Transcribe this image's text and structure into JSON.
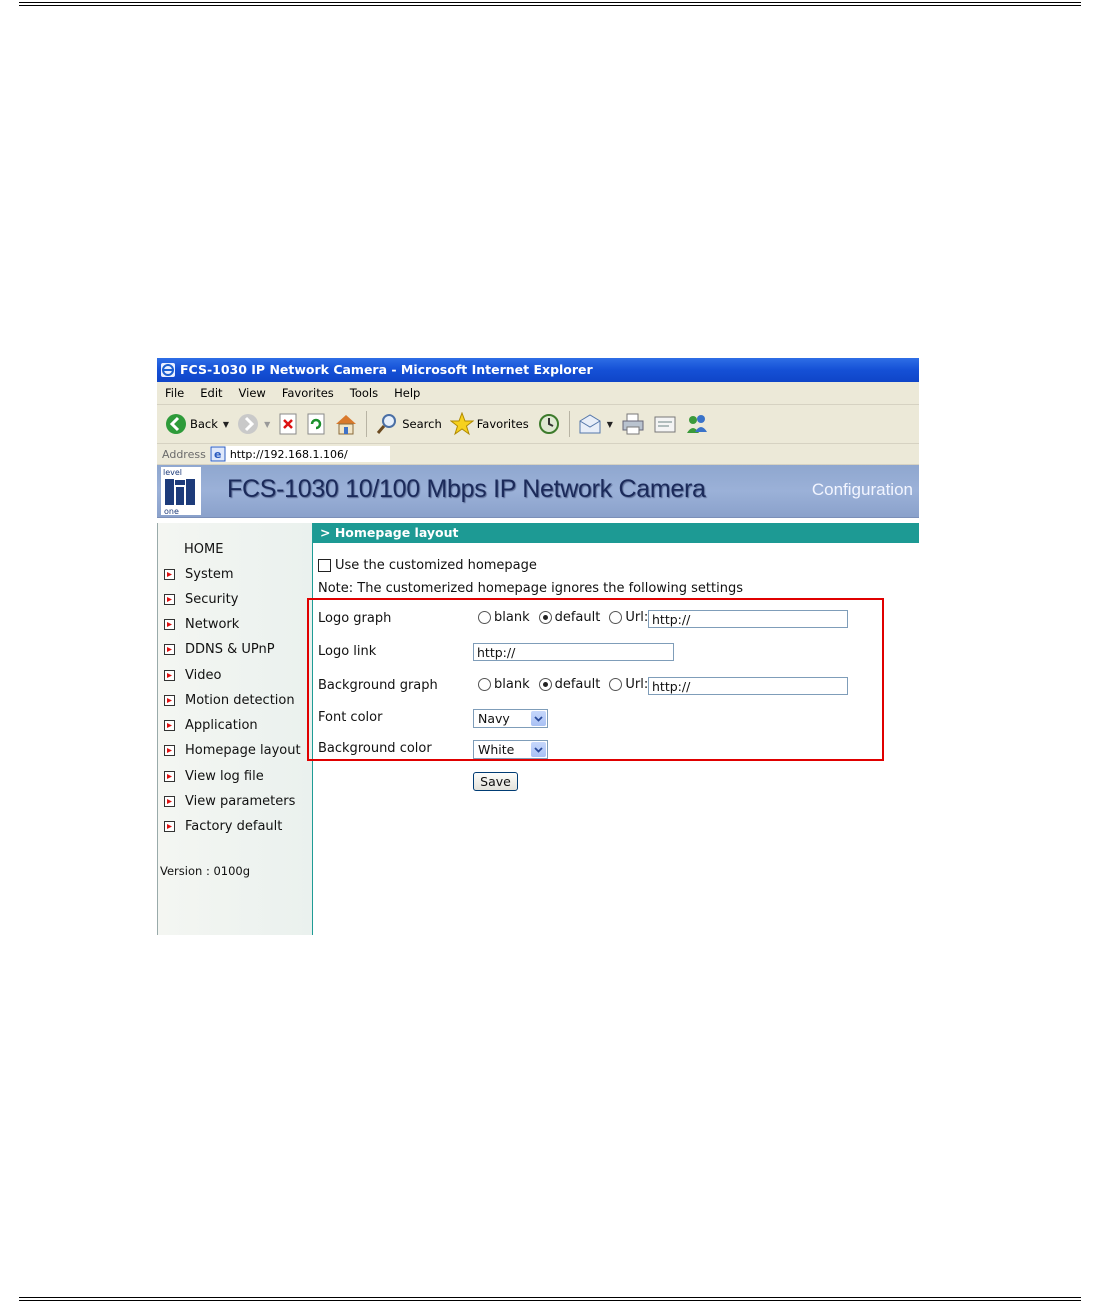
{
  "browser": {
    "title": "FCS-1030 IP Network Camera - Microsoft Internet Explorer",
    "menu": [
      "File",
      "Edit",
      "View",
      "Favorites",
      "Tools",
      "Help"
    ],
    "toolbar": {
      "back_label": "Back",
      "search_label": "Search",
      "favorites_label": "Favorites"
    },
    "address_label": "Address",
    "address_url": "http://192.168.1.106/"
  },
  "banner": {
    "logo_top": "level",
    "logo_bottom": "one",
    "title": "FCS-1030  10/100 Mbps IP Network Camera",
    "right": "Configuration"
  },
  "sidebar": {
    "home": "HOME",
    "items": [
      "System",
      "Security",
      "Network",
      "DDNS & UPnP",
      "Video",
      "Motion detection",
      "Application",
      "Homepage layout",
      "View log file",
      "View parameters",
      "Factory default"
    ],
    "version": "Version : 0100g"
  },
  "content": {
    "section_title": "> Homepage layout",
    "custom_checkbox_label": "Use the customized homepage",
    "note": "Note: The customerized homepage ignores the following settings",
    "logo_graph": {
      "label": "Logo graph",
      "options": [
        "blank",
        "default",
        "Url:"
      ],
      "selected": "default",
      "url_value": "http://"
    },
    "logo_link": {
      "label": "Logo link",
      "value": "http://"
    },
    "background_graph": {
      "label": "Background graph",
      "options": [
        "blank",
        "default",
        "Url:"
      ],
      "selected": "default",
      "url_value": "http://"
    },
    "font_color": {
      "label": "Font color",
      "value": "Navy"
    },
    "background_color": {
      "label": "Background color",
      "value": "White"
    },
    "save_label": "Save"
  },
  "colors": {
    "section_bar": "#1d9a94",
    "banner": "#9bb1d8",
    "highlight": "#e00000",
    "titlebar": "#1550d6"
  }
}
